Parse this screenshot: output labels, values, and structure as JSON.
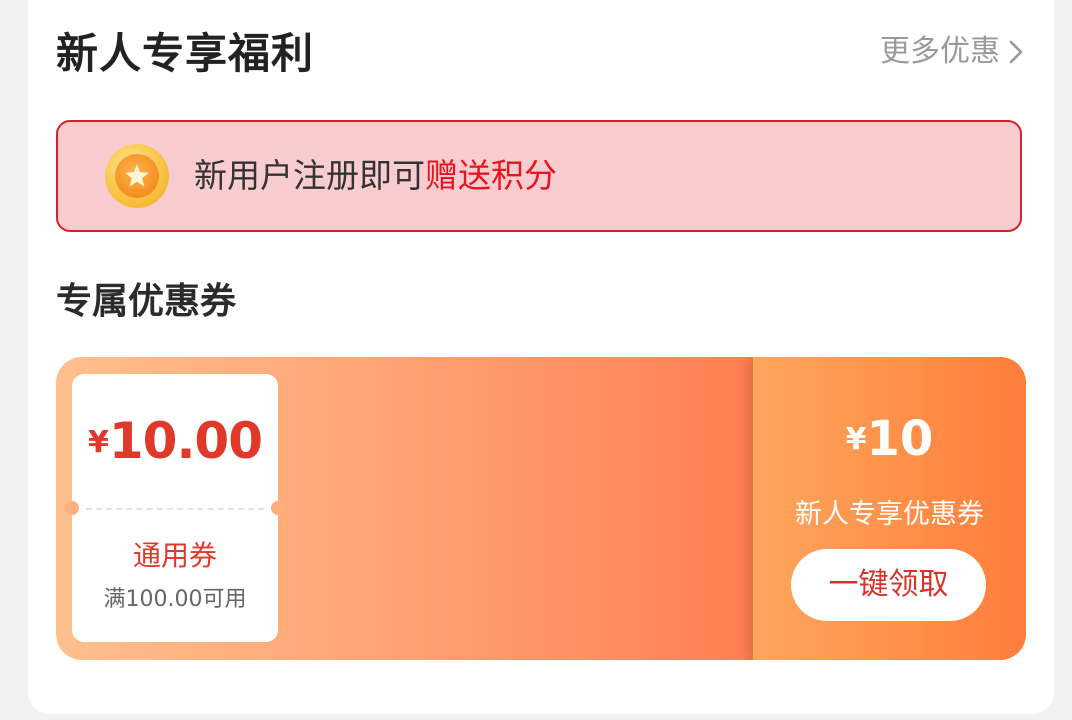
{
  "section": {
    "title": "新人专享福利",
    "more_label": "更多优惠"
  },
  "points_banner": {
    "text_prefix": "新用户注册即可",
    "text_highlight": "赠送积分",
    "icon": "coin-star-icon"
  },
  "coupon_section": {
    "heading": "专属优惠券"
  },
  "coupons": [
    {
      "currency": "¥",
      "amount": "10.00",
      "type": "通用券",
      "condition": "满100.00可用"
    }
  ],
  "claim_panel": {
    "currency": "¥",
    "total_amount": "10",
    "label": "新人专享优惠券",
    "button_label": "一键领取"
  },
  "colors": {
    "accent_red": "#e8141e",
    "coupon_red": "#e0392b",
    "banner_border": "#d9202c",
    "banner_bg": "#f9cdcf",
    "gradient_start": "#ffbf8e",
    "gradient_end": "#ff6f47"
  }
}
